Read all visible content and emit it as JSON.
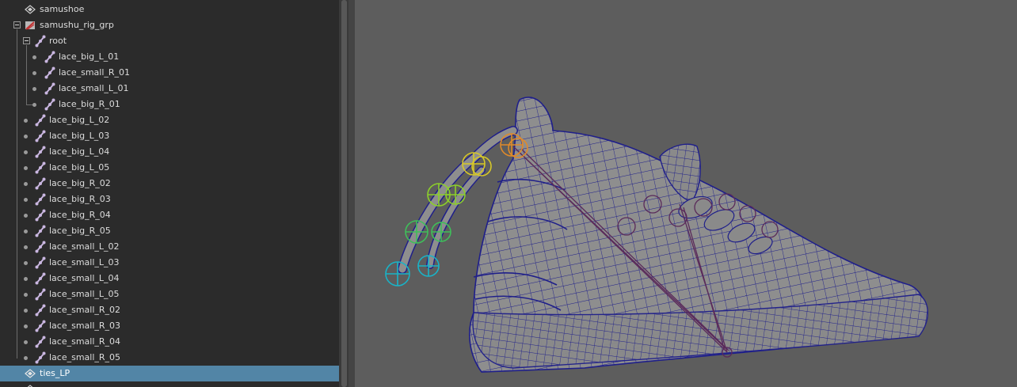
{
  "outliner": {
    "items": [
      {
        "label": "samushoe",
        "icon": "mesh-icon"
      },
      {
        "label": "samushu_rig_grp",
        "icon": "group-icon"
      },
      {
        "label": "root",
        "icon": "joint-icon"
      },
      {
        "label": "lace_big_L_01",
        "icon": "joint-icon"
      },
      {
        "label": "lace_small_R_01",
        "icon": "joint-icon"
      },
      {
        "label": "lace_small_L_01",
        "icon": "joint-icon"
      },
      {
        "label": "lace_big_R_01",
        "icon": "joint-icon"
      },
      {
        "label": "lace_big_L_02",
        "icon": "joint-icon"
      },
      {
        "label": "lace_big_L_03",
        "icon": "joint-icon"
      },
      {
        "label": "lace_big_L_04",
        "icon": "joint-icon"
      },
      {
        "label": "lace_big_L_05",
        "icon": "joint-icon"
      },
      {
        "label": "lace_big_R_02",
        "icon": "joint-icon"
      },
      {
        "label": "lace_big_R_03",
        "icon": "joint-icon"
      },
      {
        "label": "lace_big_R_04",
        "icon": "joint-icon"
      },
      {
        "label": "lace_big_R_05",
        "icon": "joint-icon"
      },
      {
        "label": "lace_small_L_02",
        "icon": "joint-icon"
      },
      {
        "label": "lace_small_L_03",
        "icon": "joint-icon"
      },
      {
        "label": "lace_small_L_04",
        "icon": "joint-icon"
      },
      {
        "label": "lace_small_L_05",
        "icon": "joint-icon"
      },
      {
        "label": "lace_small_R_02",
        "icon": "joint-icon"
      },
      {
        "label": "lace_small_R_03",
        "icon": "joint-icon"
      },
      {
        "label": "lace_small_R_04",
        "icon": "joint-icon"
      },
      {
        "label": "lace_small_R_05",
        "icon": "joint-icon"
      },
      {
        "label": "ties_LP",
        "icon": "mesh-icon",
        "selected": true
      }
    ]
  },
  "colors": {
    "outliner_bg": "#2b2b2b",
    "selection": "#5285a6",
    "viewport_bg": "#5d5d5d",
    "wireframe": "#1f1f8a",
    "mesh_fill": "#8e8e8e",
    "lace_ctrl_cyan": "#19b3c7",
    "lace_ctrl_green": "#3fbf5a",
    "lace_ctrl_lime": "#8ccf2a",
    "lace_ctrl_yellow": "#d7c828",
    "lace_ctrl_orange": "#e08a2a",
    "joint_purple": "#5a2a5a"
  }
}
